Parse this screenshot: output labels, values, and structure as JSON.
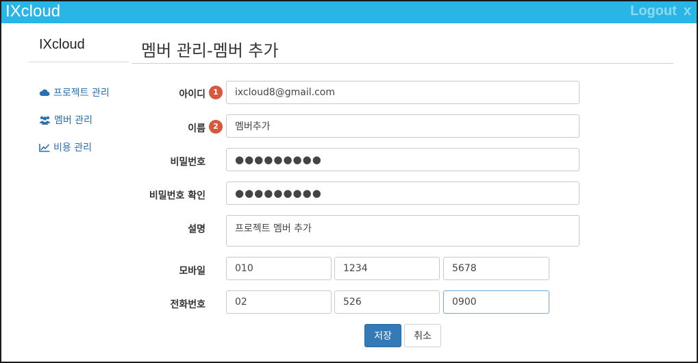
{
  "header": {
    "brand": "IXcloud",
    "logout": "Logout",
    "close": "x"
  },
  "sidebar": {
    "title": "IXcloud",
    "items": [
      {
        "label": "프로젝트 관리",
        "icon": "cloud-icon"
      },
      {
        "label": "멤버 관리",
        "icon": "users-icon"
      },
      {
        "label": "비용 관리",
        "icon": "chart-line-icon"
      }
    ]
  },
  "page": {
    "title": "멤버 관리-멤버 추가"
  },
  "form": {
    "id": {
      "label": "아이디",
      "badge": "1",
      "value": "ixcloud8@gmail.com"
    },
    "name": {
      "label": "이름",
      "badge": "2",
      "value": "멤버추가"
    },
    "password": {
      "label": "비밀번호",
      "value": "●●●●●●●●●"
    },
    "password_confirm": {
      "label": "비밀번호 확인",
      "value": "●●●●●●●●●"
    },
    "description": {
      "label": "설명",
      "value": "프로젝트 멤버 추가"
    },
    "mobile": {
      "label": "모바일",
      "parts": [
        "010",
        "1234",
        "5678"
      ]
    },
    "phone": {
      "label": "전화번호",
      "parts": [
        "02",
        "526",
        "0900"
      ]
    },
    "save_label": "저장",
    "cancel_label": "취소"
  },
  "colors": {
    "topbar": "#29b6e6",
    "badge": "#d9573c",
    "primary": "#337ab7",
    "link": "#2a6fb0"
  }
}
